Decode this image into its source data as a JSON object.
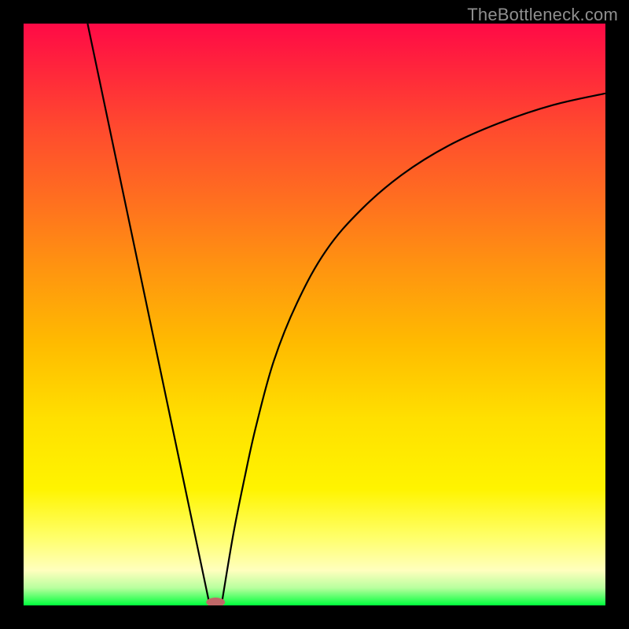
{
  "watermark": "TheBottleneck.com",
  "chart_data": {
    "type": "line",
    "title": "",
    "xlabel": "",
    "ylabel": "",
    "xlim": [
      0,
      100
    ],
    "ylim": [
      0,
      100
    ],
    "curve_left": {
      "description": "steep descending line from top-left to valley",
      "x": [
        11,
        32
      ],
      "y": [
        100,
        0
      ]
    },
    "curve_right": {
      "description": "ascending saturating curve from valley toward top-right",
      "x": [
        34,
        36,
        38,
        40,
        43,
        47,
        52,
        58,
        65,
        73,
        82,
        91,
        100
      ],
      "y": [
        0,
        12,
        22,
        31,
        42,
        52,
        61,
        68,
        74,
        79,
        83,
        86,
        88
      ]
    },
    "valley_marker": {
      "x": 33,
      "y": 0,
      "color": "#c06868"
    },
    "background_gradient": [
      "#ff0a46",
      "#ffbb00",
      "#ffff66",
      "#00ff3c"
    ]
  }
}
